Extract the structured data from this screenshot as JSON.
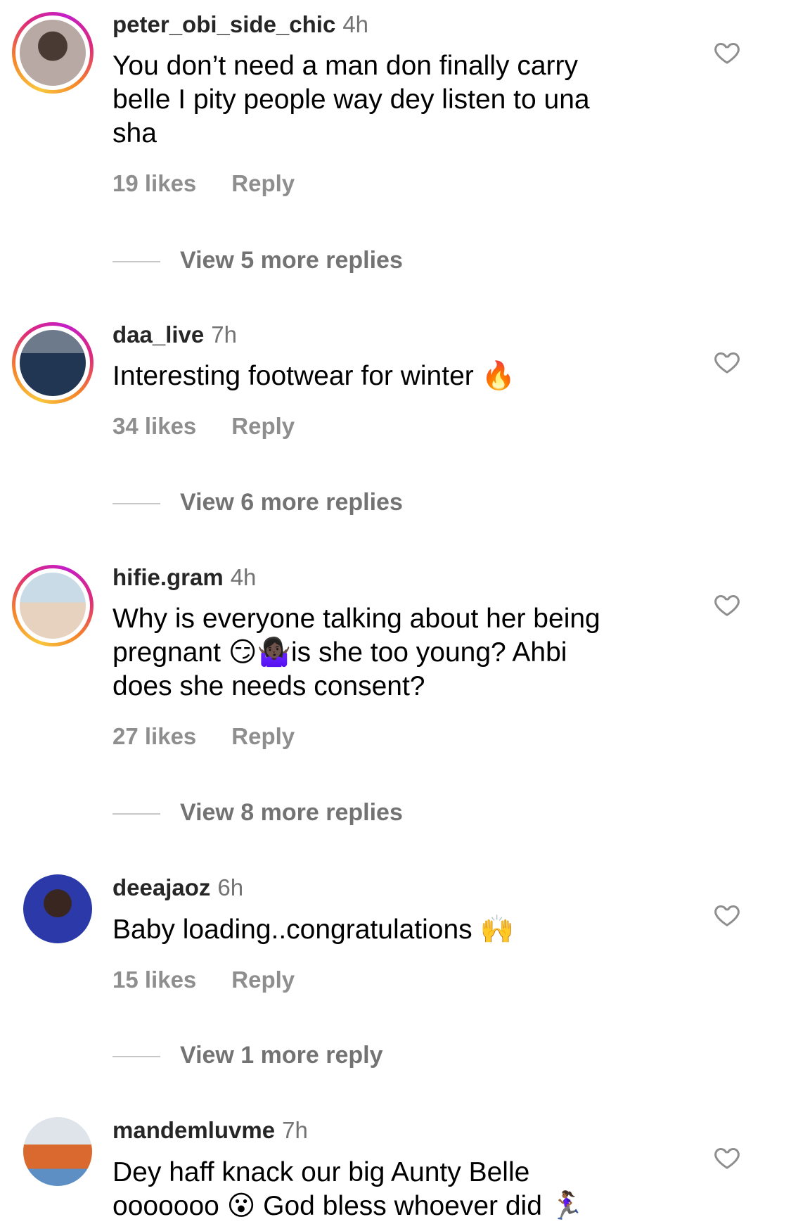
{
  "colors": {
    "username": "#262626",
    "secondary_text": "#737373",
    "action_text": "#8e8e8e",
    "divider": "#c7c7c7",
    "story_ring": [
      "#f9c73d",
      "#f58529",
      "#dd2a7b",
      "#c41ec8"
    ]
  },
  "comments": [
    {
      "username": "peter_obi_side_chic",
      "time": "4h",
      "text_lines": [
        "You don’t need a man don finally carry",
        "belle I pity people way dey listen to una",
        "sha"
      ],
      "likes": "19 likes",
      "reply_label": "Reply",
      "view_replies": "View 5 more replies",
      "avatar_icon": "profile-photo-woman",
      "story_ring": true
    },
    {
      "username": "daa_live",
      "time": "7h",
      "text_lines": [
        "Interesting footwear for winter 🔥"
      ],
      "likes": "34 likes",
      "reply_label": "Reply",
      "view_replies": "View 6 more replies",
      "avatar_icon": "profile-photo-man-suit",
      "story_ring": true
    },
    {
      "username": "hifie.gram",
      "time": "4h",
      "text_lines": [
        "Why is everyone talking about her being",
        "pregnant 😏🤷🏿‍♀️is she too young? Ahbi",
        "does she needs consent?"
      ],
      "likes": "27 likes",
      "reply_label": "Reply",
      "view_replies": "View 8 more replies",
      "avatar_icon": "profile-photo-woman-seated",
      "story_ring": true
    },
    {
      "username": "deeajaoz",
      "time": "6h",
      "text_lines": [
        "Baby loading..congratulations 🙌"
      ],
      "likes": "15 likes",
      "reply_label": "Reply",
      "view_replies": "View 1 more reply",
      "avatar_icon": "profile-photo-woman-blue",
      "story_ring": false
    },
    {
      "username": "mandemluvme",
      "time": "7h",
      "text_lines": [
        "Dey haff knack our big Aunty Belle",
        "ooooooo 😮 God bless whoever did 🏃🏾‍♀️"
      ],
      "avatar_icon": "profile-photo-woman-orange",
      "story_ring": false
    }
  ],
  "icons": {
    "like": "heart-outline-icon"
  }
}
